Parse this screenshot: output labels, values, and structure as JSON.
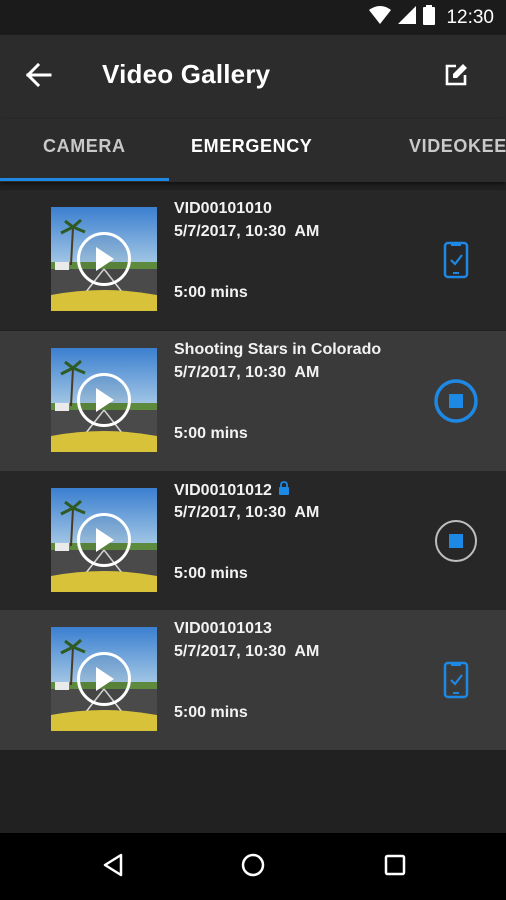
{
  "status_bar": {
    "time": "12:30",
    "icons": [
      "wifi-icon",
      "signal-icon",
      "battery-icon"
    ]
  },
  "app_bar": {
    "title": "Video Gallery",
    "back_icon": "arrow-back-icon",
    "edit_icon": "edit-icon"
  },
  "tabs": [
    {
      "label": "CAMERA",
      "active": false
    },
    {
      "label": "EMERGENCY",
      "active": true
    },
    {
      "label": "VIDEOKEEPER",
      "active": false
    }
  ],
  "videos": [
    {
      "name": "VID00101010",
      "date": "5/7/2017, 10:30  AM",
      "duration": "5:00 mins",
      "locked": false,
      "status": "phone-check-icon"
    },
    {
      "name": "Shooting Stars in Colorado",
      "date": "5/7/2017, 10:30  AM",
      "duration": "5:00 mins",
      "locked": false,
      "status": "download-progress-stop-icon"
    },
    {
      "name": "VID00101012",
      "date": "5/7/2017, 10:30  AM",
      "duration": "5:00 mins",
      "locked": true,
      "status": "stop-download-icon"
    },
    {
      "name": "VID00101013",
      "date": "5/7/2017, 10:30  AM",
      "duration": "5:00 mins",
      "locked": false,
      "status": "phone-check-icon"
    }
  ],
  "colors": {
    "accent": "#1e88e5",
    "row_dark": "#272727",
    "row_light": "#3a3a3a",
    "app_bar": "#2c2c2c"
  },
  "nav_bar": {
    "icons": [
      "back-triangle-icon",
      "home-circle-icon",
      "recents-square-icon"
    ]
  }
}
